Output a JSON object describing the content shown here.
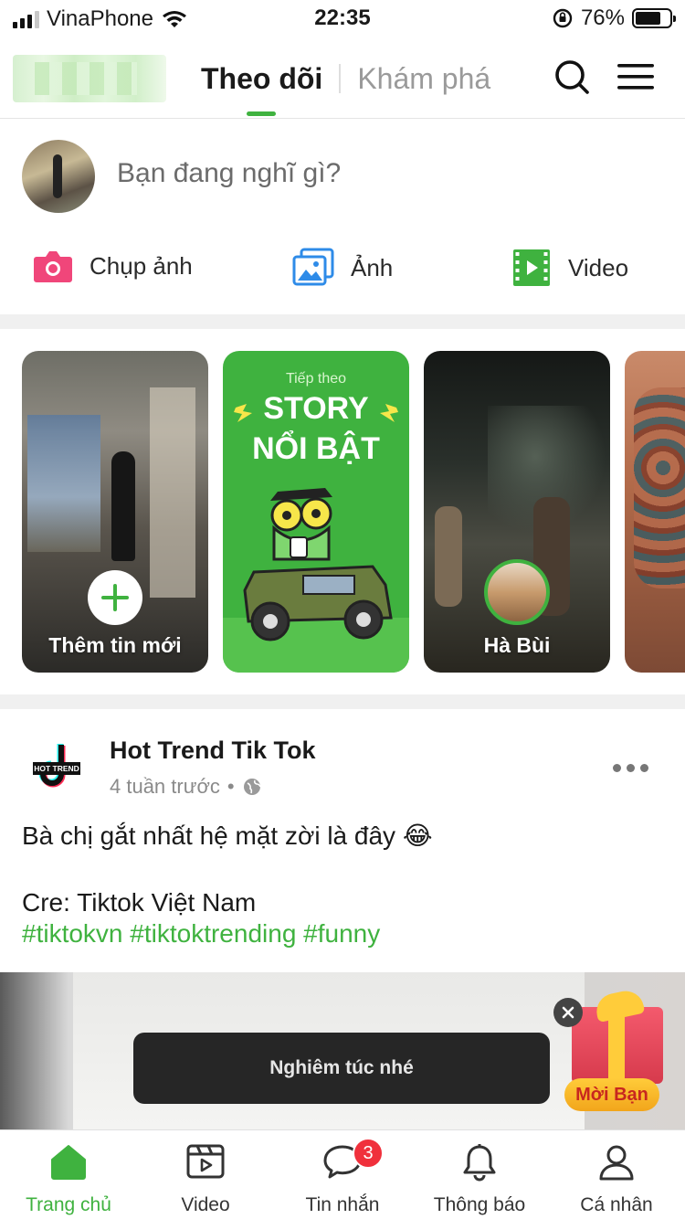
{
  "status_bar": {
    "carrier": "VinaPhone",
    "time": "22:35",
    "battery": "76%",
    "battery_level": 0.76
  },
  "header": {
    "tabs": [
      {
        "label": "Theo dõi",
        "active": true
      },
      {
        "label": "Khám phá",
        "active": false
      }
    ],
    "icons": [
      "search-icon",
      "menu-icon"
    ]
  },
  "composer": {
    "prompt": "Bạn đang nghĩ gì?",
    "actions": [
      {
        "label": "Chụp ảnh",
        "icon": "camera-icon",
        "color": "#f0467a"
      },
      {
        "label": "Ảnh",
        "icon": "photo-icon",
        "color": "#2e8be8"
      },
      {
        "label": "Video",
        "icon": "video-icon",
        "color": "#3fb23f"
      }
    ]
  },
  "stories": {
    "add_label": "Thêm tin mới",
    "featured": {
      "small": "Tiếp theo",
      "line1": "STORY",
      "line2": "NỔI BẬT"
    },
    "user_story": "Hà Bùi"
  },
  "post": {
    "author": "Hot Trend Tik Tok",
    "time": "4 tuần trước",
    "text": "Bà chị gắt nhất hệ mặt zời là đây 😂",
    "credit": "Cre: Tiktok Việt Nam",
    "hashtags": "#tiktokvn #tiktoktrending #funny",
    "media_caption": "Nghiêm túc nhé",
    "avatar_text": "HOT TREND"
  },
  "gift": {
    "label": "Mời Bạn"
  },
  "tabbar": {
    "items": [
      {
        "label": "Trang chủ",
        "icon": "home-icon",
        "active": true
      },
      {
        "label": "Video",
        "icon": "video-player-icon",
        "active": false
      },
      {
        "label": "Tin nhắn",
        "icon": "chat-icon",
        "active": false,
        "badge": "3"
      },
      {
        "label": "Thông báo",
        "icon": "bell-icon",
        "active": false
      },
      {
        "label": "Cá nhân",
        "icon": "person-icon",
        "active": false
      }
    ]
  },
  "colors": {
    "accent": "#3fb23f",
    "badge": "#f0303c"
  }
}
